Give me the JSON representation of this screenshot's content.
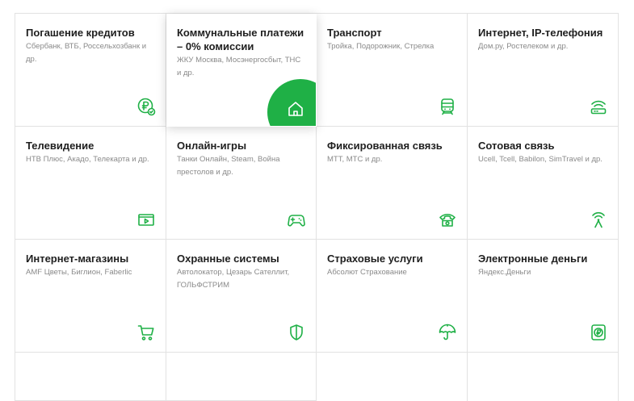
{
  "accent_color": "#1fb046",
  "tiles": [
    {
      "title": "Погашение кредитов",
      "subtitle": "Сбербанк, ВТБ, Россельхозбанк и др.",
      "icon": "ruble-check-icon"
    },
    {
      "title": "Коммунальные платежи – 0% комиссии",
      "subtitle": "ЖКУ Москва, Мосэнергосбыт, ТНС и др.",
      "icon": "home-icon",
      "active": true
    },
    {
      "title": "Транспорт",
      "subtitle": "Тройка, Подорожник, Стрелка",
      "icon": "train-icon"
    },
    {
      "title": "Интернет, IP-телефония",
      "subtitle": "Дом.ру, Ростелеком и др.",
      "icon": "wifi-router-icon"
    },
    {
      "title": "Телевидение",
      "subtitle": "НТВ Плюс, Акадо, Телекарта и др.",
      "icon": "tv-icon"
    },
    {
      "title": "Онлайн-игры",
      "subtitle": "Танки Онлайн, Steam, Война престолов и др.",
      "icon": "gamepad-icon"
    },
    {
      "title": "Фиксированная связь",
      "subtitle": "МТТ, МТС и др.",
      "icon": "phone-icon"
    },
    {
      "title": "Сотовая связь",
      "subtitle": "Ucell, Tcell, Babilon, SimTravel и др.",
      "icon": "antenna-icon"
    },
    {
      "title": "Интернет-магазины",
      "subtitle": "AMF Цветы, Биглион, Faberlic",
      "icon": "cart-icon"
    },
    {
      "title": "Охранные системы",
      "subtitle": "Автолокатор, Цезарь Сателлит, ГОЛЬФСТРИМ",
      "icon": "shield-icon"
    },
    {
      "title": "Страховые услуги",
      "subtitle": "Абсолют Страхование",
      "icon": "umbrella-icon"
    },
    {
      "title": "Электронные деньги",
      "subtitle": "Яндекс.Деньги",
      "icon": "ruble-wallet-icon"
    }
  ]
}
